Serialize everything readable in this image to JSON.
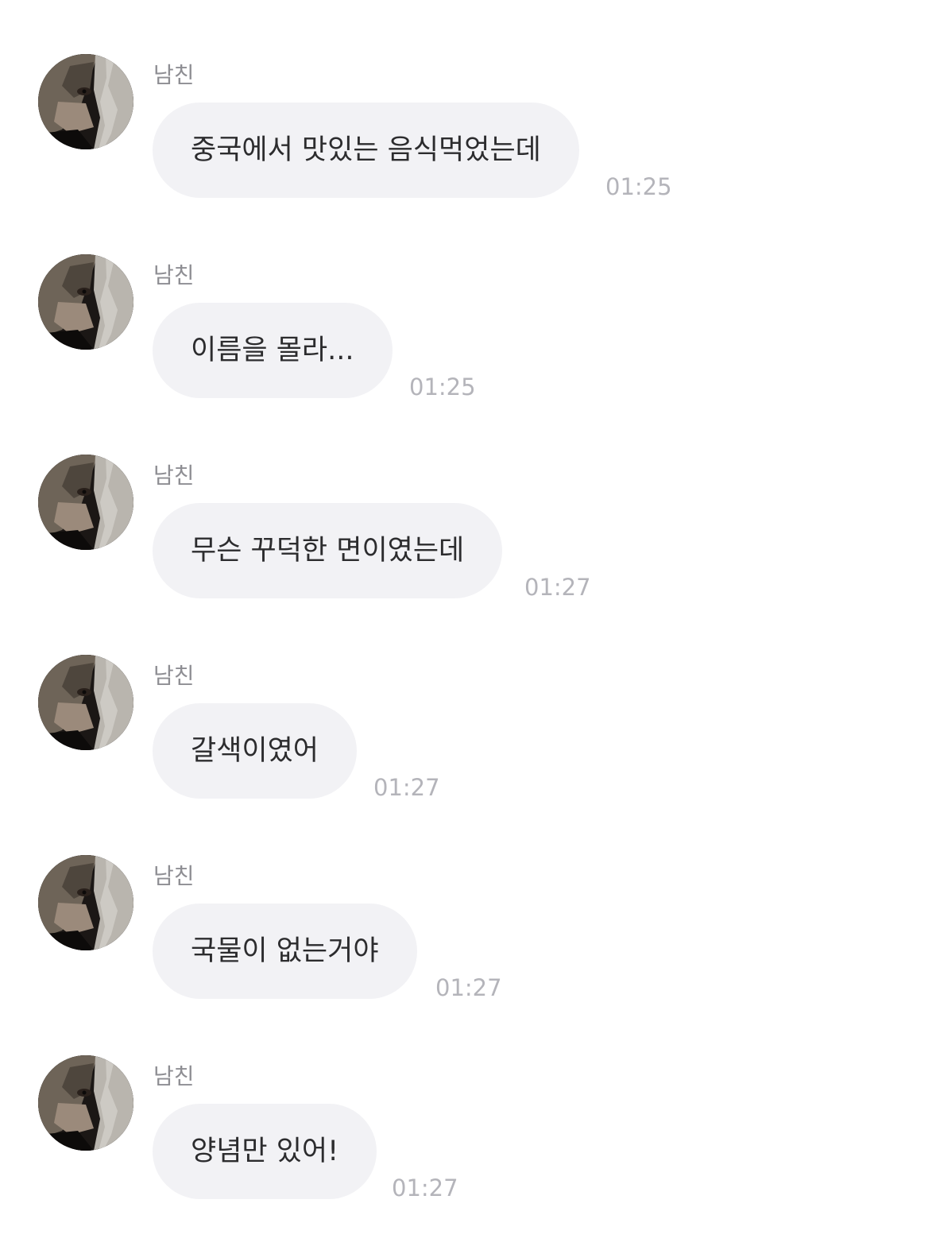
{
  "sender_name": "남친",
  "avatar": {
    "icon": "profile-photo"
  },
  "messages": [
    {
      "text": "중국에서 맛있는 음식먹었는데",
      "time": "01:25"
    },
    {
      "text": "이름을 몰라...",
      "time": "01:25"
    },
    {
      "text": "무슨 꾸덕한 면이였는데",
      "time": "01:27"
    },
    {
      "text": "갈색이였어",
      "time": "01:27"
    },
    {
      "text": "국물이 없는거야",
      "time": "01:27"
    },
    {
      "text": "양념만 있어!",
      "time": "01:27"
    }
  ],
  "colors": {
    "bubble": "#f2f2f5",
    "bubble_text": "#2c2c2e",
    "sender_text": "#8e8e93",
    "time_text": "#b4b4ba",
    "background": "#ffffff"
  }
}
